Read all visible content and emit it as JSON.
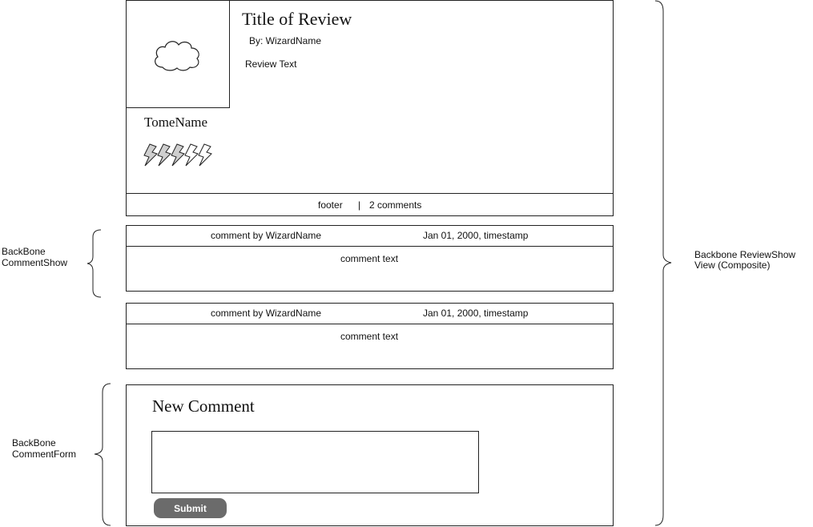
{
  "review": {
    "title": "Title of Review",
    "byline": "By: WizardName",
    "text": "Review Text",
    "tome_name": "TomeName",
    "image_icon": "cloud-icon",
    "rating_icon": "lightning-bolt-icon",
    "rating": {
      "value": 3,
      "max": 5
    },
    "footer": {
      "label": "footer",
      "separator": "|",
      "comments": "2 comments"
    }
  },
  "comments": [
    {
      "author": "comment by WizardName",
      "timestamp": "Jan 01, 2000, timestamp",
      "text": "comment text"
    },
    {
      "author": "comment by WizardName",
      "timestamp": "Jan 01, 2000, timestamp",
      "text": "comment text"
    }
  ],
  "comment_form": {
    "title": "New Comment",
    "input_value": "",
    "submit_label": "Submit"
  },
  "annotations": {
    "comment_show": [
      "BackBone",
      "CommentShow"
    ],
    "comment_form": [
      "BackBone",
      "CommentForm"
    ],
    "review_show": [
      "Backbone ReviewShow",
      "View (Composite)"
    ]
  },
  "colors": {
    "line": "#222222",
    "button": "#6b6b6b",
    "bolt_fill": "#cfcfcf"
  }
}
